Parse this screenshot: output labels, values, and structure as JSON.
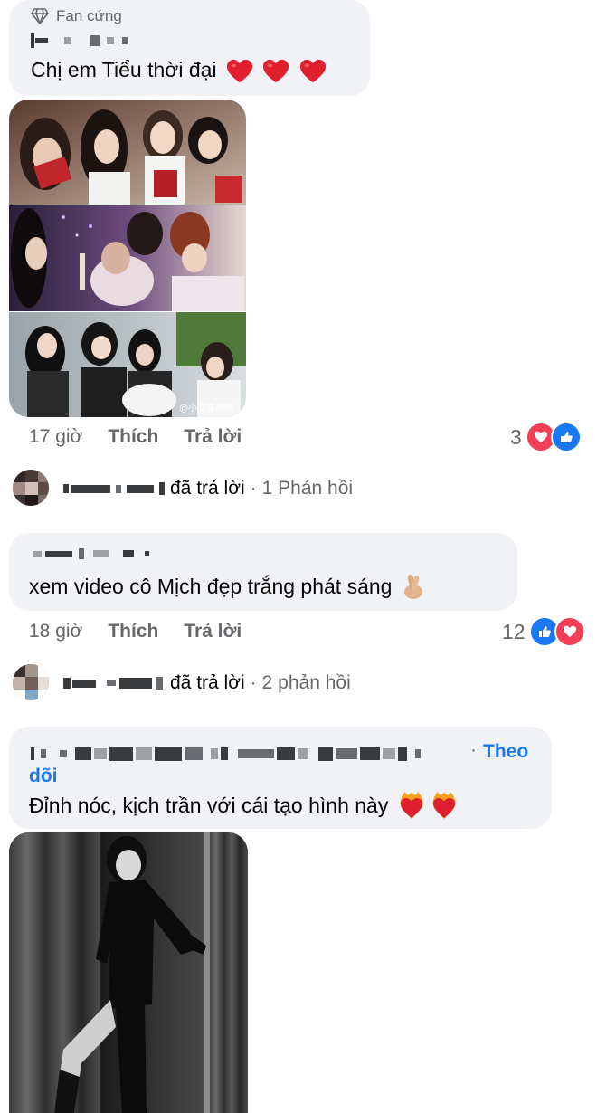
{
  "comment1": {
    "badge_label": "Fan cứng",
    "text": "Chị em Tiểu thời đại",
    "time": "17 giờ",
    "like_label": "Thích",
    "reply_label": "Trả lời",
    "reaction_count": "3",
    "reactions": [
      "love-icon",
      "like-icon"
    ],
    "photo_watermark": "@小安喜欢啊"
  },
  "reply_summary1": {
    "action": "đã trả lời",
    "separator": "·",
    "count_text": "1 Phản hồi"
  },
  "comment2": {
    "text": "xem video cô Mịch đẹp trắng phát sáng",
    "emoji": "crossed-fingers-emoji",
    "time": "18 giờ",
    "like_label": "Thích",
    "reply_label": "Trả lời",
    "reaction_count": "12",
    "reactions": [
      "like-icon",
      "love-icon"
    ]
  },
  "reply_summary2": {
    "action": "đã trả lời",
    "separator": "·",
    "count_text": "2 phản hồi"
  },
  "comment3": {
    "follow_label": "Theo dõi",
    "separator": "·",
    "text": "Đỉnh nóc, kịch trần với cái tạo hình này",
    "emoji": "heart-on-fire-emoji"
  },
  "colors": {
    "bubble_bg": "#f0f2f5",
    "meta_text": "#65676b",
    "link_blue": "#1877f2",
    "love_red": "#f33e58",
    "emoji_red": "#e0202f"
  }
}
